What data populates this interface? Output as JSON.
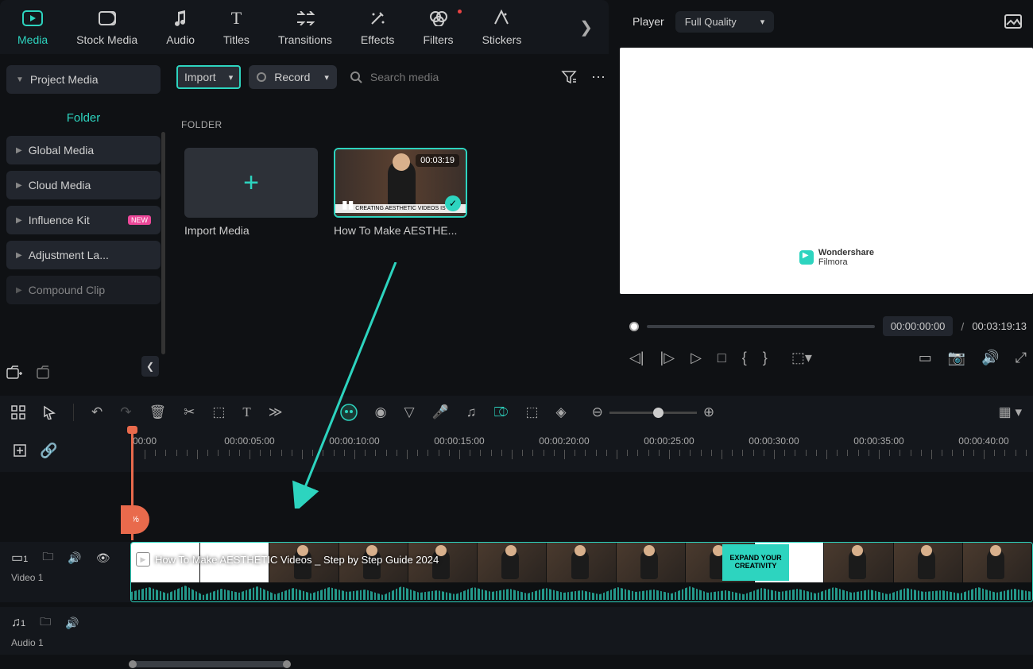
{
  "tabs": {
    "media": "Media",
    "stock": "Stock Media",
    "audio": "Audio",
    "titles": "Titles",
    "transitions": "Transitions",
    "effects": "Effects",
    "filters": "Filters",
    "stickers": "Stickers"
  },
  "player": {
    "title": "Player",
    "quality": "Full Quality",
    "current": "00:00:00:00",
    "duration": "00:03:19:13",
    "sep": "/"
  },
  "sidebar": {
    "project": "Project Media",
    "folder": "Folder",
    "global": "Global Media",
    "cloud": "Cloud Media",
    "influence": "Influence Kit",
    "new_badge": "NEW",
    "adjust": "Adjustment La...",
    "compound": "Compound Clip"
  },
  "mediabar": {
    "import": "Import",
    "record": "Record",
    "search_ph": "Search media"
  },
  "folder_label": "FOLDER",
  "media_items": {
    "import_media": "Import Media",
    "clip1_title": "How To Make AESTHE...",
    "clip1_dur": "00:03:19",
    "clip1_banner": "CREATING AESTHETIC VIDEOS IS"
  },
  "preview": {
    "brand1": "Wondershare",
    "brand2": "Filmora"
  },
  "ruler": [
    "00:00",
    "00:00:05:00",
    "00:00:10:00",
    "00:00:15:00",
    "00:00:20:00",
    "00:00:25:00",
    "00:00:30:00",
    "00:00:35:00",
    "00:00:40:00"
  ],
  "ai_badge": "%",
  "track": {
    "video_num": "1",
    "video_label": "Video 1",
    "audio_num": "1",
    "audio_label": "Audio 1",
    "clip_title": "How To Make AESTHETIC Videos _ Step by Step Guide 2024",
    "expand": "EXPAND YOUR CREATIVITY"
  }
}
